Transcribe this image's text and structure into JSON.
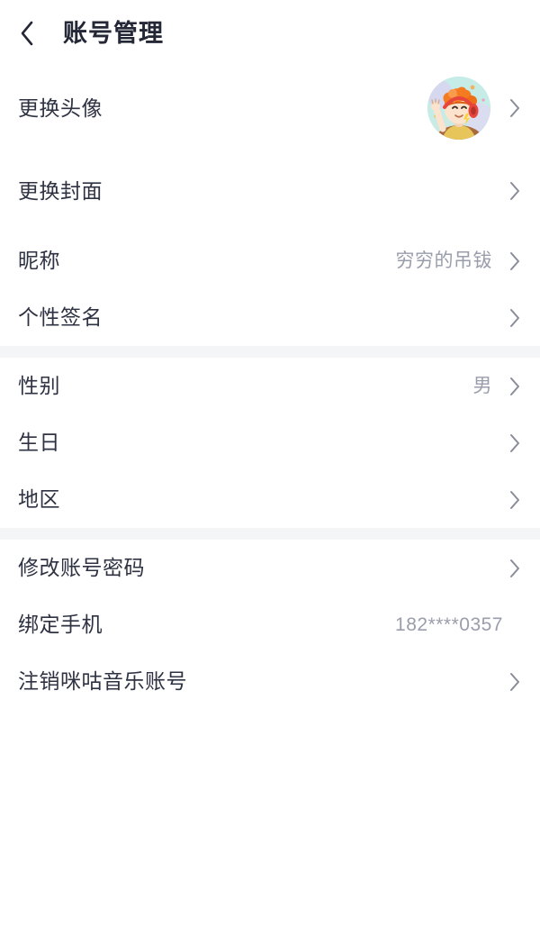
{
  "header": {
    "title": "账号管理",
    "back_icon": "chevron-left-icon"
  },
  "colors": {
    "background": "#ffffff",
    "section_gap": "#f4f5f7",
    "label_text": "#2e3242",
    "value_text": "#9a9dab",
    "chevron": "#8a8d99",
    "back_chevron": "#242836"
  },
  "sections": [
    {
      "rows": [
        {
          "label": "更换头像",
          "value": "",
          "avatar": true,
          "chevron": true
        },
        {
          "label": "更换封面",
          "value": "",
          "avatar": false,
          "chevron": true
        },
        {
          "label": "昵称",
          "value": "穷穷的吊钹",
          "avatar": false,
          "chevron": true
        },
        {
          "label": "个性签名",
          "value": "",
          "avatar": false,
          "chevron": true
        }
      ]
    },
    {
      "rows": [
        {
          "label": "性别",
          "value": "男",
          "avatar": false,
          "chevron": true
        },
        {
          "label": "生日",
          "value": "",
          "avatar": false,
          "chevron": true
        },
        {
          "label": "地区",
          "value": "",
          "avatar": false,
          "chevron": true
        }
      ]
    },
    {
      "rows": [
        {
          "label": "修改账号密码",
          "value": "",
          "avatar": false,
          "chevron": true
        },
        {
          "label": "绑定手机",
          "value": "182****0357",
          "avatar": false,
          "chevron": false
        },
        {
          "label": "注销咪咕音乐账号",
          "value": "",
          "avatar": false,
          "chevron": true
        }
      ]
    }
  ],
  "avatar": {
    "icon_name": "user-avatar-image",
    "description": "卡通头像",
    "bg_color": "#c6ece8",
    "hair_color": "#f47b20",
    "headphone_color": "#e8453c",
    "skin_color": "#fbe3cd",
    "shirt_color": "#e8c55a"
  }
}
